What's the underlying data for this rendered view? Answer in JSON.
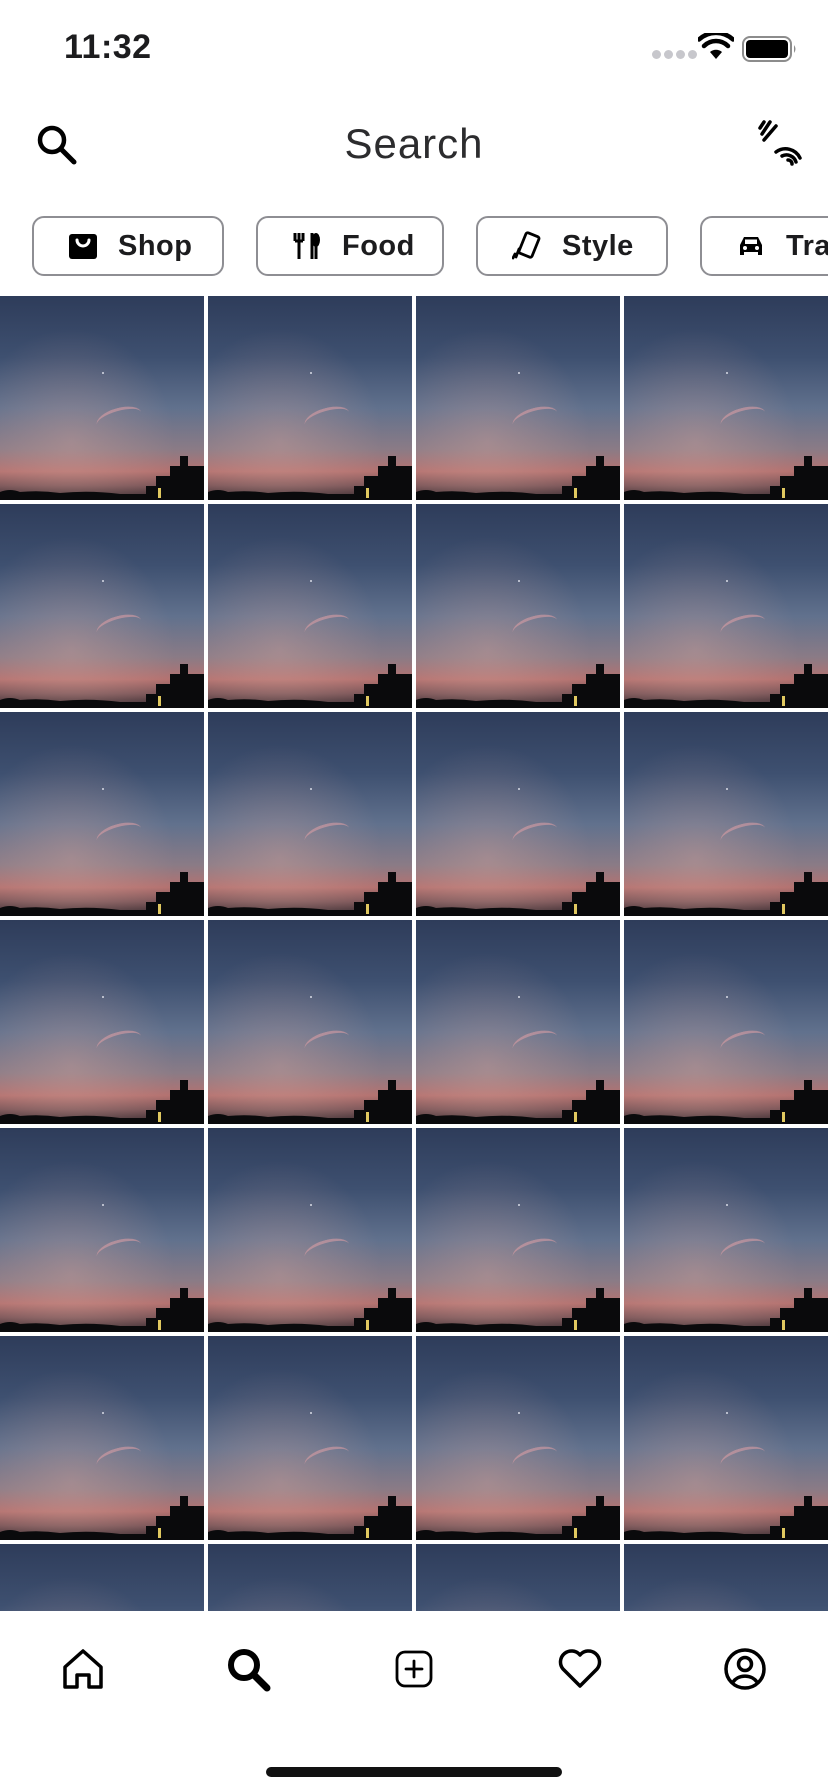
{
  "status_bar": {
    "time": "11:32",
    "icons": [
      "signal-icon",
      "wifi-icon",
      "battery-icon"
    ]
  },
  "header": {
    "title": "Search",
    "left_icon": "search-icon",
    "right_icon": "nfc-icon"
  },
  "categories": [
    {
      "label": "Shop",
      "icon": "shopping-bag-icon"
    },
    {
      "label": "Food",
      "icon": "utensils-icon"
    },
    {
      "label": "Style",
      "icon": "style-icon"
    },
    {
      "label": "Travel",
      "icon": "car-icon"
    }
  ],
  "grid": {
    "columns": 4,
    "visible_rows": 7,
    "tile_content": "sunset-sky-photo"
  },
  "tab_bar": {
    "tabs": [
      {
        "icon": "home-icon",
        "active": false
      },
      {
        "icon": "search-icon",
        "active": true
      },
      {
        "icon": "add-post-icon",
        "active": false
      },
      {
        "icon": "heart-icon",
        "active": false
      },
      {
        "icon": "profile-icon",
        "active": false
      }
    ]
  },
  "colors": {
    "background": "#ffffff",
    "text": "#1c1c1e",
    "chip_border": "#8e8e93",
    "icon": "#000000"
  }
}
